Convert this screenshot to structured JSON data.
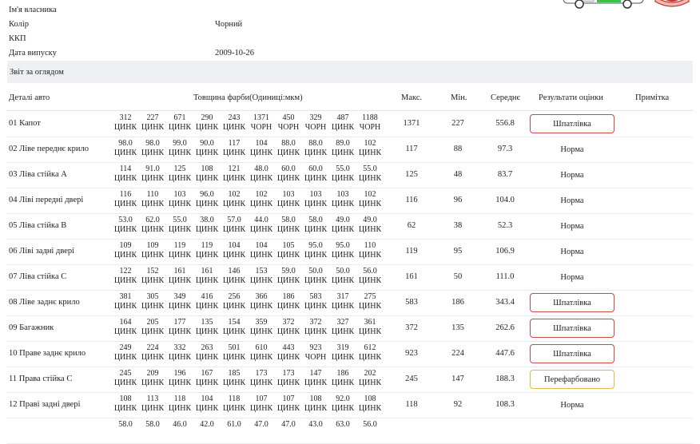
{
  "info": [
    {
      "label": "Ім'я власника",
      "value": ""
    },
    {
      "label": "Колір",
      "value": "Чорний"
    },
    {
      "label": "ККП",
      "value": ""
    },
    {
      "label": "Дата випуску",
      "value": "2009-10-26"
    }
  ],
  "section_title": "Звіт за оглядом",
  "table": {
    "headers": {
      "part": "Деталі авто",
      "thickness": "Товщина фарби(Одиниці:мкм)",
      "max": "Макс.",
      "min": "Мін.",
      "avg": "Середнє",
      "result": "Результати оцінки",
      "note": "Примітка"
    },
    "rows": [
      {
        "name": "01  Капот",
        "m": [
          [
            "312",
            "ЦИНК"
          ],
          [
            "227",
            "ЦИНК"
          ],
          [
            "671",
            "ЦИНК"
          ],
          [
            "290",
            "ЦИНК"
          ],
          [
            "243",
            "ЦИНК"
          ],
          [
            "1371",
            "ЧОРН"
          ],
          [
            "450",
            "ЧОРН"
          ],
          [
            "329",
            "ЧОРН"
          ],
          [
            "487",
            "ЦИНК"
          ],
          [
            "1188",
            "ЧОРН"
          ]
        ],
        "max": "1371",
        "min": "227",
        "avg": "556.8",
        "result": "Шпатлівка",
        "status": "bad"
      },
      {
        "name": "02  Ліве переднє крило",
        "m": [
          [
            "98.0",
            "ЦИНК"
          ],
          [
            "98.0",
            "ЦИНК"
          ],
          [
            "99.0",
            "ЦИНК"
          ],
          [
            "90.0",
            "ЦИНК"
          ],
          [
            "117",
            "ЦИНК"
          ],
          [
            "104",
            "ЦИНК"
          ],
          [
            "88.0",
            "ЦИНК"
          ],
          [
            "88.0",
            "ЦИНК"
          ],
          [
            "89.0",
            "ЦИНК"
          ],
          [
            "102",
            "ЦИНК"
          ]
        ],
        "max": "117",
        "min": "88",
        "avg": "97.3",
        "result": "Норма",
        "status": "ok"
      },
      {
        "name": "03  Ліва стійка А",
        "m": [
          [
            "114",
            "ЦИНК"
          ],
          [
            "91.0",
            "ЦИНК"
          ],
          [
            "125",
            "ЦИНК"
          ],
          [
            "108",
            "ЦИНК"
          ],
          [
            "121",
            "ЦИНК"
          ],
          [
            "48.0",
            "ЦИНК"
          ],
          [
            "60.0",
            "ЦИНК"
          ],
          [
            "60.0",
            "ЦИНК"
          ],
          [
            "55.0",
            "ЦИНК"
          ],
          [
            "55.0",
            "ЦИНК"
          ]
        ],
        "max": "125",
        "min": "48",
        "avg": "83.7",
        "result": "Норма",
        "status": "ok"
      },
      {
        "name": "04  Ліві передні двері",
        "m": [
          [
            "116",
            "ЦИНК"
          ],
          [
            "110",
            "ЦИНК"
          ],
          [
            "103",
            "ЦИНК"
          ],
          [
            "96.0",
            "ЦИНК"
          ],
          [
            "102",
            "ЦИНК"
          ],
          [
            "102",
            "ЦИНК"
          ],
          [
            "103",
            "ЦИНК"
          ],
          [
            "103",
            "ЦИНК"
          ],
          [
            "103",
            "ЦИНК"
          ],
          [
            "102",
            "ЦИНК"
          ]
        ],
        "max": "116",
        "min": "96",
        "avg": "104.0",
        "result": "Норма",
        "status": "ok"
      },
      {
        "name": "05  Ліва стійка В",
        "m": [
          [
            "53.0",
            "ЦИНК"
          ],
          [
            "62.0",
            "ЦИНК"
          ],
          [
            "55.0",
            "ЦИНК"
          ],
          [
            "38.0",
            "ЦИНК"
          ],
          [
            "57.0",
            "ЦИНК"
          ],
          [
            "44.0",
            "ЦИНК"
          ],
          [
            "58.0",
            "ЦИНК"
          ],
          [
            "58.0",
            "ЦИНК"
          ],
          [
            "49.0",
            "ЦИНК"
          ],
          [
            "49.0",
            "ЦИНК"
          ]
        ],
        "max": "62",
        "min": "38",
        "avg": "52.3",
        "result": "Норма",
        "status": "ok"
      },
      {
        "name": "06  Ліві задні двері",
        "m": [
          [
            "109",
            "ЦИНК"
          ],
          [
            "109",
            "ЦИНК"
          ],
          [
            "119",
            "ЦИНК"
          ],
          [
            "119",
            "ЦИНК"
          ],
          [
            "104",
            "ЦИНК"
          ],
          [
            "104",
            "ЦИНК"
          ],
          [
            "105",
            "ЦИНК"
          ],
          [
            "95.0",
            "ЦИНК"
          ],
          [
            "95.0",
            "ЦИНК"
          ],
          [
            "110",
            "ЦИНК"
          ]
        ],
        "max": "119",
        "min": "95",
        "avg": "106.9",
        "result": "Норма",
        "status": "ok"
      },
      {
        "name": "07  Ліва стійка С",
        "m": [
          [
            "122",
            "ЦИНК"
          ],
          [
            "152",
            "ЦИНК"
          ],
          [
            "161",
            "ЦИНК"
          ],
          [
            "161",
            "ЦИНК"
          ],
          [
            "146",
            "ЦИНК"
          ],
          [
            "153",
            "ЦИНК"
          ],
          [
            "59.0",
            "ЦИНК"
          ],
          [
            "50.0",
            "ЦИНК"
          ],
          [
            "50.0",
            "ЦИНК"
          ],
          [
            "56.0",
            "ЦИНК"
          ]
        ],
        "max": "161",
        "min": "50",
        "avg": "111.0",
        "result": "Норма",
        "status": "ok"
      },
      {
        "name": "08  Ліве заднє крило",
        "m": [
          [
            "381",
            "ЦИНК"
          ],
          [
            "305",
            "ЦИНК"
          ],
          [
            "349",
            "ЦИНК"
          ],
          [
            "416",
            "ЦИНК"
          ],
          [
            "256",
            "ЦИНК"
          ],
          [
            "366",
            "ЦИНК"
          ],
          [
            "186",
            "ЦИНК"
          ],
          [
            "583",
            "ЦИНК"
          ],
          [
            "317",
            "ЦИНК"
          ],
          [
            "275",
            "ЦИНК"
          ]
        ],
        "max": "583",
        "min": "186",
        "avg": "343.4",
        "result": "Шпатлівка",
        "status": "bad"
      },
      {
        "name": "09  Багажник",
        "m": [
          [
            "164",
            "ЦИНК"
          ],
          [
            "205",
            "ЦИНК"
          ],
          [
            "177",
            "ЦИНК"
          ],
          [
            "135",
            "ЦИНК"
          ],
          [
            "154",
            "ЦИНК"
          ],
          [
            "359",
            "ЦИНК"
          ],
          [
            "372",
            "ЦИНК"
          ],
          [
            "372",
            "ЦИНК"
          ],
          [
            "327",
            "ЦИНК"
          ],
          [
            "361",
            "ЦИНК"
          ]
        ],
        "max": "372",
        "min": "135",
        "avg": "262.6",
        "result": "Шпатлівка",
        "status": "bad"
      },
      {
        "name": "10  Праве заднє крило",
        "m": [
          [
            "249",
            "ЦИНК"
          ],
          [
            "224",
            "ЦИНК"
          ],
          [
            "332",
            "ЦИНК"
          ],
          [
            "263",
            "ЦИНК"
          ],
          [
            "501",
            "ЦИНК"
          ],
          [
            "610",
            "ЦИНК"
          ],
          [
            "443",
            "ЦИНК"
          ],
          [
            "923",
            "ЧОРН"
          ],
          [
            "319",
            "ЦИНК"
          ],
          [
            "612",
            "ЦИНК"
          ]
        ],
        "max": "923",
        "min": "224",
        "avg": "447.6",
        "result": "Шпатлівка",
        "status": "bad"
      },
      {
        "name": "11  Права стійка С",
        "m": [
          [
            "245",
            "ЦИНК"
          ],
          [
            "209",
            "ЦИНК"
          ],
          [
            "196",
            "ЦИНК"
          ],
          [
            "167",
            "ЦИНК"
          ],
          [
            "185",
            "ЦИНК"
          ],
          [
            "173",
            "ЦИНК"
          ],
          [
            "173",
            "ЦИНК"
          ],
          [
            "147",
            "ЦИНК"
          ],
          [
            "186",
            "ЦИНК"
          ],
          [
            "202",
            "ЦИНК"
          ]
        ],
        "max": "245",
        "min": "147",
        "avg": "188.3",
        "result": "Перефарбовано",
        "status": "warn"
      },
      {
        "name": "12  Праві задні двері",
        "m": [
          [
            "108",
            "ЦИНК"
          ],
          [
            "113",
            "ЦИНК"
          ],
          [
            "118",
            "ЦИНК"
          ],
          [
            "104",
            "ЦИНК"
          ],
          [
            "118",
            "ЦИНК"
          ],
          [
            "107",
            "ЦИНК"
          ],
          [
            "107",
            "ЦИНК"
          ],
          [
            "108",
            "ЦИНК"
          ],
          [
            "92.0",
            "ЦИНК"
          ],
          [
            "108",
            "ЦИНК"
          ]
        ],
        "max": "118",
        "min": "92",
        "avg": "108.3",
        "result": "Норма",
        "status": "ok"
      },
      {
        "name": "",
        "m": [
          [
            "58.0",
            ""
          ],
          [
            "58.0",
            ""
          ],
          [
            "46.0",
            ""
          ],
          [
            "42.0",
            ""
          ],
          [
            "61.0",
            ""
          ],
          [
            "47.0",
            ""
          ],
          [
            "47.0",
            ""
          ],
          [
            "43.0",
            ""
          ],
          [
            "63.0",
            ""
          ],
          [
            "56.0",
            ""
          ]
        ],
        "max": "",
        "min": "",
        "avg": "",
        "result": "",
        "status": "ok"
      }
    ]
  },
  "colors": {
    "bad": "#d64545",
    "warn": "#e4b84a",
    "section_bg": "#eef0f3"
  },
  "icons": {
    "car_top": "car-top-view-icon",
    "car_badge": "car-front-icon"
  }
}
